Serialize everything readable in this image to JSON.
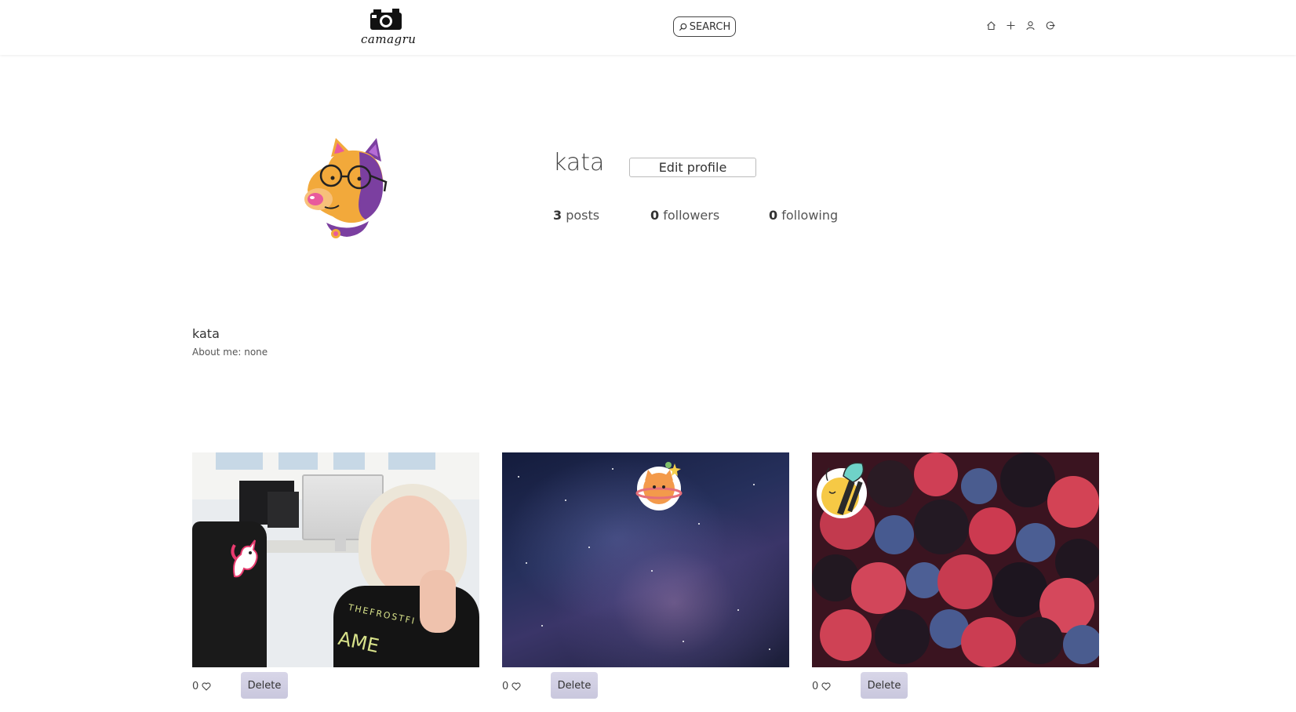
{
  "header": {
    "logo_text": "camagru",
    "search_label": "SEARCH",
    "nav_icons": [
      "home-icon",
      "plus-icon",
      "user-icon",
      "logout-icon"
    ]
  },
  "profile": {
    "username": "kata",
    "edit_label": "Edit profile",
    "stats": {
      "posts_count": "3",
      "posts_label": "posts",
      "followers_count": "0",
      "followers_label": "followers",
      "following_count": "0",
      "following_label": "following"
    },
    "bio_name": "kata",
    "about": "About me: none"
  },
  "posts": [
    {
      "likes": "0",
      "delete_label": "Delete"
    },
    {
      "likes": "0",
      "delete_label": "Delete"
    },
    {
      "likes": "0",
      "delete_label": "Delete"
    }
  ],
  "colors": {
    "accent": "#d8d6e8",
    "avatar_purple": "#7b3fa0",
    "avatar_orange": "#f2a93b"
  }
}
